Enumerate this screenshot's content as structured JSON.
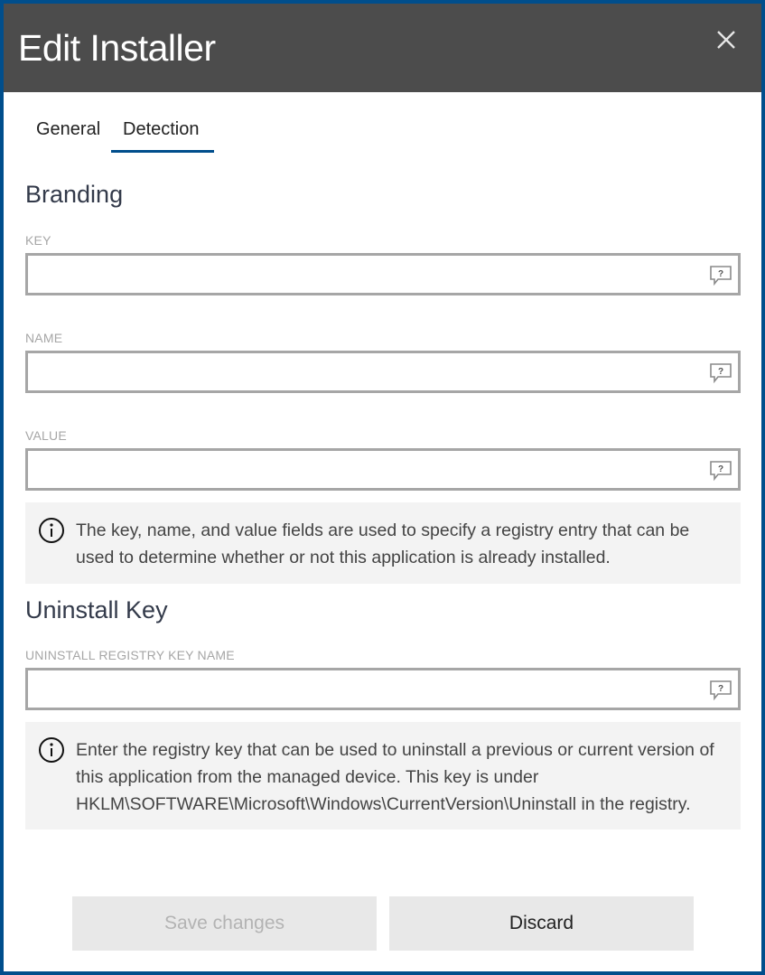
{
  "dialog": {
    "title": "Edit Installer",
    "close_icon": "close-icon"
  },
  "tabs": [
    {
      "label": "General",
      "active": false
    },
    {
      "label": "Detection",
      "active": true
    }
  ],
  "branding": {
    "section_title": "Branding",
    "fields": [
      {
        "label": "KEY",
        "value": "",
        "help_icon": "help-tooltip-icon"
      },
      {
        "label": "NAME",
        "value": "",
        "help_icon": "help-tooltip-icon"
      },
      {
        "label": "VALUE",
        "value": "",
        "help_icon": "help-tooltip-icon"
      }
    ],
    "info": "The key, name, and value fields are used to specify a registry entry that can be used to determine whether or not this application is already installed."
  },
  "uninstall": {
    "section_title": "Uninstall Key",
    "fields": [
      {
        "label": "UNINSTALL REGISTRY KEY NAME",
        "value": "",
        "help_icon": "help-tooltip-icon"
      }
    ],
    "info": "Enter the registry key that can be used to uninstall a previous or current version of this application from the managed device. This key is under HKLM\\SOFTWARE\\Microsoft\\Windows\\CurrentVersion\\Uninstall in the registry."
  },
  "footer": {
    "save_label": "Save changes",
    "save_enabled": false,
    "discard_label": "Discard"
  },
  "colors": {
    "accent": "#004e8c",
    "header_bg": "#4c4c4c",
    "info_bg": "#f3f3f3",
    "field_border": "#a6a6a6"
  }
}
